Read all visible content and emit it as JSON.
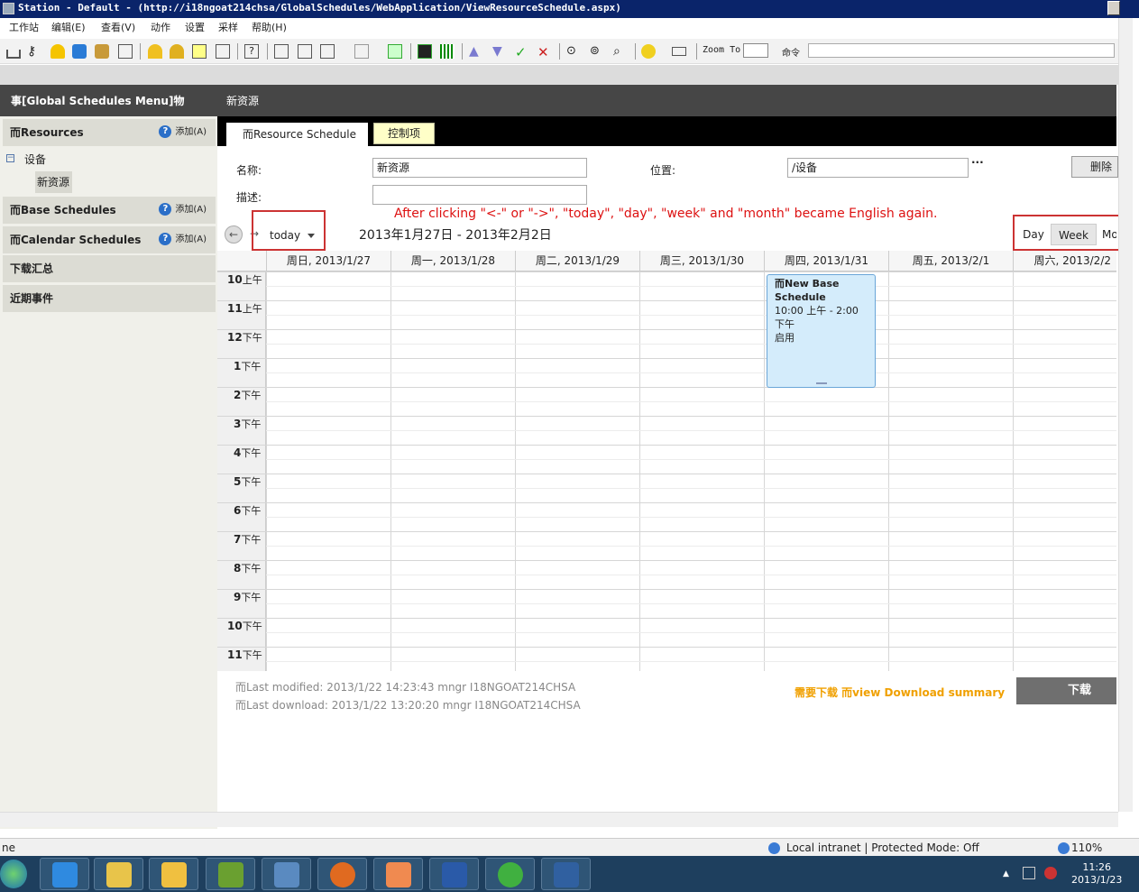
{
  "window": {
    "title": "Station - Default - (http://i18ngoat214chsa/GlobalSchedules/WebApplication/ViewResourceSchedule.aspx)"
  },
  "menu": [
    "工作站",
    "编辑(E)",
    "查看(V)",
    "动作",
    "设置",
    "采样",
    "帮助(H)"
  ],
  "toolbar": {
    "zoom_label": "Zoom To F:",
    "command_label": "命令"
  },
  "header": {
    "menu_title": "事[Global Schedules Menu]物",
    "page_title": "新资源"
  },
  "sidebar": {
    "resources": {
      "label": "而Resources",
      "add": "添加(A)"
    },
    "tree": {
      "folder": "设备",
      "child": "新资源"
    },
    "base_schedules": {
      "label": "而Base Schedules",
      "add": "添加(A)"
    },
    "calendar_schedules": {
      "label": "而Calendar Schedules",
      "add": "添加(A)"
    },
    "download_summary": "下载汇总",
    "recent_events": "近期事件"
  },
  "tabs": {
    "resource_schedule": "而Resource Schedule",
    "controls": "控制项"
  },
  "form": {
    "name_label": "名称:",
    "name_value": "新资源",
    "location_label": "位置:",
    "location_value": "/设备",
    "location_more": "...",
    "desc_label": "描述:",
    "desc_value": "",
    "delete_label": "删除"
  },
  "annotation": "After clicking \"<-\" or \"->\", \"today\", \"day\", \"week\" and \"month\" became English again.",
  "calendar": {
    "today": "today",
    "date_range": "2013年1月27日 - 2013年2月2日",
    "views": {
      "day": "Day",
      "week": "Week",
      "month": "Mo"
    },
    "days": [
      "周日, 2013/1/27",
      "周一, 2013/1/28",
      "周二, 2013/1/29",
      "周三, 2013/1/30",
      "周四, 2013/1/31",
      "周五, 2013/2/1",
      "周六, 2013/2/2"
    ],
    "hours": [
      {
        "h": "10",
        "ap": "上午"
      },
      {
        "h": "11",
        "ap": "上午"
      },
      {
        "h": "12",
        "ap": "下午"
      },
      {
        "h": "1",
        "ap": "下午"
      },
      {
        "h": "2",
        "ap": "下午"
      },
      {
        "h": "3",
        "ap": "下午"
      },
      {
        "h": "4",
        "ap": "下午"
      },
      {
        "h": "5",
        "ap": "下午"
      },
      {
        "h": "6",
        "ap": "下午"
      },
      {
        "h": "7",
        "ap": "下午"
      },
      {
        "h": "8",
        "ap": "下午"
      },
      {
        "h": "9",
        "ap": "下午"
      },
      {
        "h": "10",
        "ap": "下午"
      },
      {
        "h": "11",
        "ap": "下午"
      }
    ],
    "event": {
      "title": "而New Base Schedule",
      "time": "10:00 上午 - 2:00 下午",
      "status": "启用"
    }
  },
  "footer": {
    "last_modified": "而Last modified: 2013/1/22 14:23:43 mngr I18NGOAT214CHSA",
    "last_download": "而Last download: 2013/1/22 13:20:20 mngr I18NGOAT214CHSA",
    "download_link": "需要下载 而view Download summary",
    "download_button": "下载"
  },
  "statusbar": {
    "left": "ne",
    "zone": "Local intranet | Protected Mode: Off",
    "zoom": "110%"
  },
  "taskbar": {
    "time": "11:26",
    "date": "2013/1/23"
  }
}
